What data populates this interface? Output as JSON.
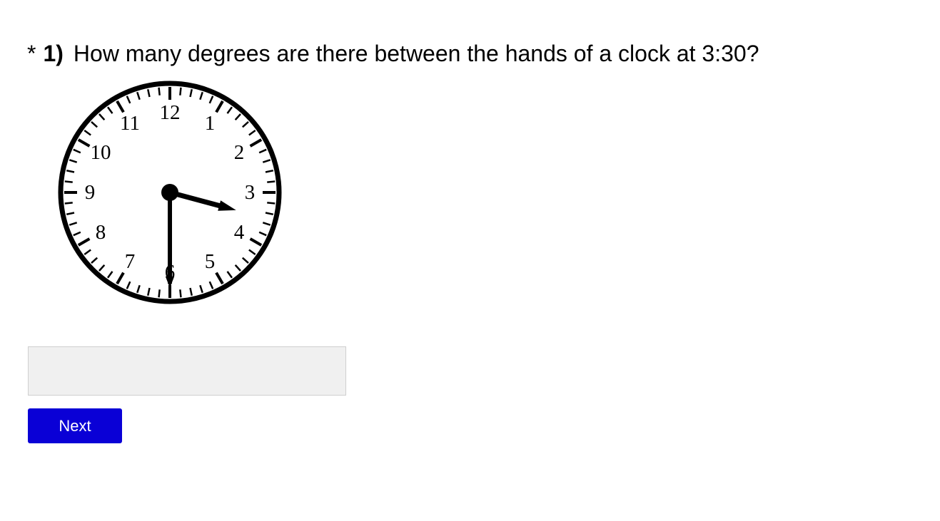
{
  "question": {
    "required_marker": "*",
    "number": "1)",
    "text": "How many degrees are there between the hands of a clock at 3:30?"
  },
  "clock": {
    "time": "3:30",
    "hour": 3,
    "minute": 30,
    "numerals": [
      "12",
      "1",
      "2",
      "3",
      "4",
      "5",
      "6",
      "7",
      "8",
      "9",
      "10",
      "11"
    ]
  },
  "answer": {
    "value": "",
    "placeholder": ""
  },
  "next_button": {
    "label": "Next",
    "color": "#0a00d6"
  }
}
